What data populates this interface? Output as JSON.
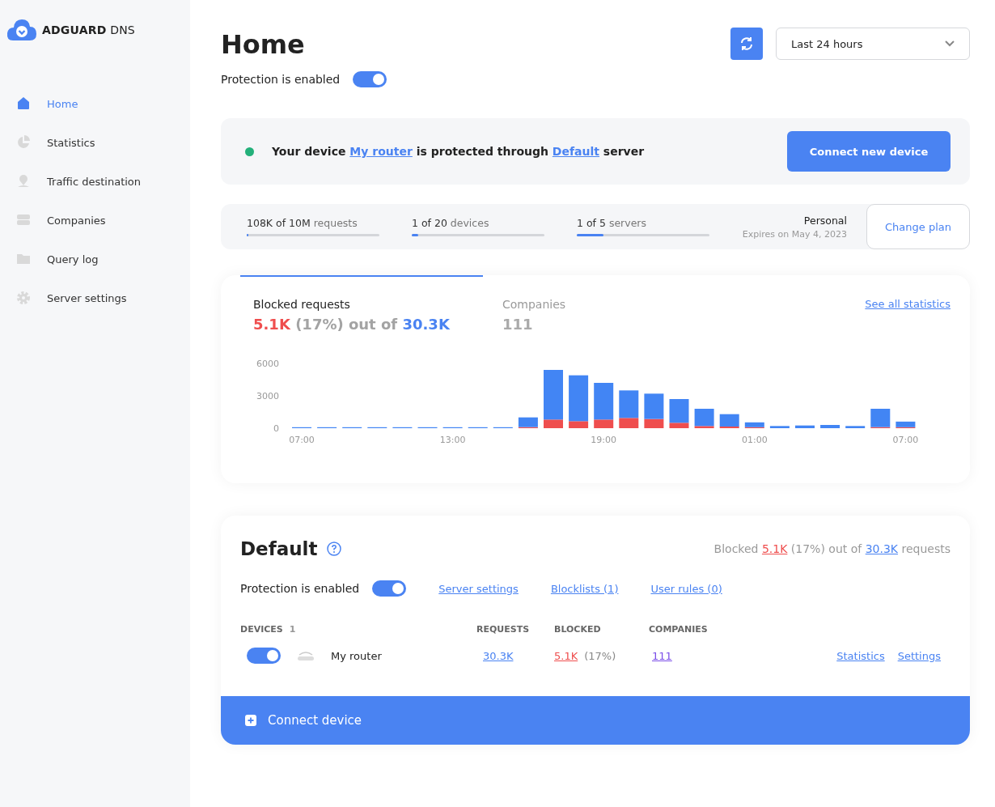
{
  "brand": {
    "name_bold": "ADGUARD",
    "name_light": "DNS"
  },
  "sidebar": {
    "items": [
      {
        "label": "Home",
        "selected": true
      },
      {
        "label": "Statistics",
        "selected": false
      },
      {
        "label": "Traffic destination",
        "selected": false
      },
      {
        "label": "Companies",
        "selected": false
      },
      {
        "label": "Query log",
        "selected": false
      },
      {
        "label": "Server settings",
        "selected": false
      }
    ]
  },
  "header": {
    "title": "Home",
    "protection_label": "Protection is enabled",
    "protection_on": true,
    "period": "Last 24 hours"
  },
  "banner": {
    "prefix": "Your device",
    "device_link": "My router",
    "middle": "is protected through",
    "server_link": "Default",
    "suffix": "server",
    "button": "Connect new device"
  },
  "usage": {
    "meters": [
      {
        "value": "108K of 10M",
        "unit": "requests",
        "level": 0.01
      },
      {
        "value": "1 of 20",
        "unit": "devices",
        "level": 0.05
      },
      {
        "value": "1 of 5",
        "unit": "servers",
        "level": 0.2
      }
    ],
    "plan": "Personal",
    "expires": "Expires on May 4, 2023",
    "button": "Change plan"
  },
  "stats": {
    "tabs": [
      {
        "label": "Blocked requests",
        "selected": true,
        "kind": "blocked",
        "blocked": "5.1K",
        "middle": "(17%) out of",
        "total": "30.3K"
      },
      {
        "label": "Companies",
        "selected": false,
        "kind": "count",
        "count": "111"
      }
    ],
    "link": "See all statistics",
    "chart_data": {
      "type": "bar",
      "stacked": true,
      "categories": [
        "07:00",
        null,
        null,
        null,
        null,
        null,
        "13:00",
        null,
        null,
        null,
        null,
        null,
        "19:00",
        null,
        null,
        null,
        null,
        null,
        "01:00",
        null,
        null,
        null,
        null,
        null,
        "07:00"
      ],
      "yticks": [
        0,
        3000,
        6000
      ],
      "ylim": [
        0,
        6000
      ],
      "series": [
        {
          "color": "#ef4e4e",
          "values": [
            0,
            0,
            0,
            0,
            0,
            0,
            0,
            0,
            0,
            100,
            800,
            650,
            800,
            950,
            850,
            500,
            200,
            150,
            50,
            0,
            0,
            0,
            0,
            100,
            80
          ]
        },
        {
          "color": "#4285f4",
          "values": [
            30,
            30,
            30,
            30,
            30,
            30,
            30,
            30,
            30,
            900,
            4600,
            4250,
            3400,
            2550,
            2350,
            2200,
            1600,
            1150,
            450,
            200,
            250,
            300,
            200,
            1700,
            520
          ]
        }
      ]
    }
  },
  "server": {
    "title": "Default",
    "summary": {
      "prefix": "Blocked",
      "blocked": "5.1K",
      "middle": "(17%) out of",
      "total": "30.3K",
      "suffix": "requests"
    },
    "protection_label": "Protection is enabled",
    "protection_on": true,
    "links": [
      "Server settings",
      "Blocklists (1)",
      "User rules (0)"
    ],
    "columns": {
      "devices": "DEVICES",
      "device_count": "1",
      "requests": "REQUESTS",
      "blocked": "BLOCKED",
      "companies": "COMPANIES"
    },
    "devices": [
      {
        "on": true,
        "name": "My router",
        "requests": "30.3K",
        "blocked": "5.1K",
        "blocked_pct": "(17%)",
        "companies": "111",
        "actions": [
          "Statistics",
          "Settings"
        ]
      }
    ],
    "connect_button": "Connect device"
  }
}
